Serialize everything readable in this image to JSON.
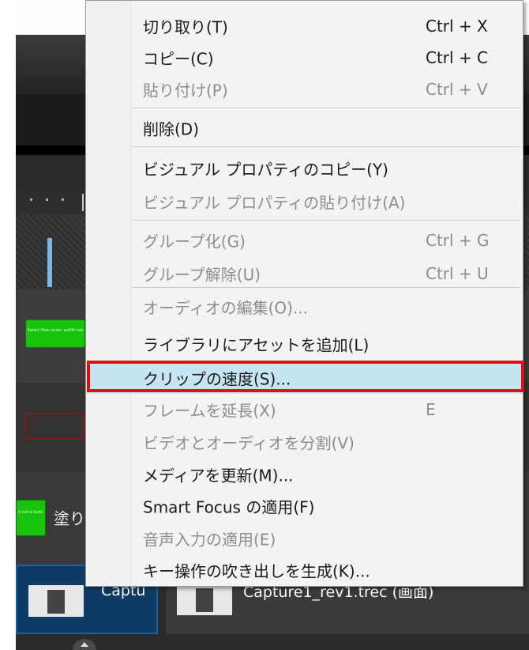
{
  "menu": {
    "items": [
      {
        "label": "切り取り(T)",
        "shortcut": "Ctrl + X",
        "enabled": true
      },
      {
        "label": "コピー(C)",
        "shortcut": "Ctrl + C",
        "enabled": true
      },
      {
        "label": "貼り付け(P)",
        "shortcut": "Ctrl + V",
        "enabled": false
      },
      {
        "label": "削除(D)",
        "shortcut": "",
        "enabled": true
      },
      {
        "label": "ビジュアル プロパティのコピー(Y)",
        "shortcut": "",
        "enabled": true
      },
      {
        "label": "ビジュアル プロパティの貼り付け(A)",
        "shortcut": "",
        "enabled": false
      },
      {
        "label": "グループ化(G)",
        "shortcut": "Ctrl + G",
        "enabled": false
      },
      {
        "label": "グループ解除(U)",
        "shortcut": "Ctrl + U",
        "enabled": false
      },
      {
        "label": "オーディオの編集(O)...",
        "shortcut": "",
        "enabled": false
      },
      {
        "label": "ライブラリにアセットを追加(L)",
        "shortcut": "",
        "enabled": true
      },
      {
        "label": "クリップの速度(S)...",
        "shortcut": "",
        "enabled": true,
        "highlighted": true
      },
      {
        "label": "フレームを延長(X)",
        "shortcut": "E",
        "enabled": false
      },
      {
        "label": "ビデオとオーディオを分割(V)",
        "shortcut": "",
        "enabled": false
      },
      {
        "label": "メディアを更新(M)...",
        "shortcut": "",
        "enabled": true
      },
      {
        "label": "Smart Focus の適用(F)",
        "shortcut": "",
        "enabled": true
      },
      {
        "label": "音声入力の適用(E)",
        "shortcut": "",
        "enabled": false
      },
      {
        "label": "キー操作の吹き出しを生成(K)...",
        "shortcut": "",
        "enabled": true
      }
    ]
  },
  "timeline": {
    "track_label_fill": "塗り",
    "clip_left_label": "Captu",
    "clip_right_label": "Capture1_rev1.trec (画面)",
    "green_clip_text": "Select flow router autfilr tab",
    "green_clip_side_text": "e tail e lacks"
  },
  "colors": {
    "highlight_bg": "#c6e4f2",
    "highlight_border": "#e20f0f",
    "disabled_text": "#8d8d8d"
  }
}
